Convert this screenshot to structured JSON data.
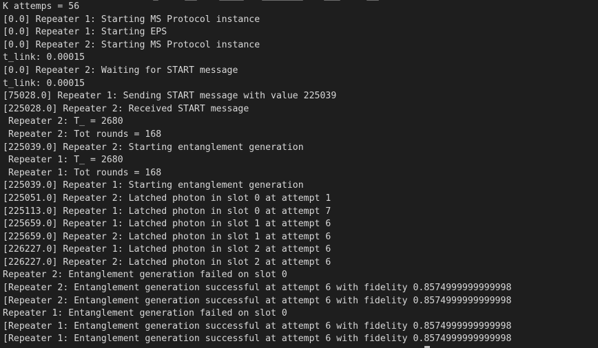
{
  "terminal": {
    "lines": [
      "K attemps = 56",
      "[0.0] Repeater 1: Starting MS Protocol instance",
      "[0.0] Repeater 1: Starting EPS",
      "[0.0] Repeater 2: Starting MS Protocol instance",
      "t_link: 0.00015",
      "[0.0] Repeater 2: Waiting for START message",
      "t_link: 0.00015",
      "[75028.0] Repeater 1: Sending START message with value 225039",
      "[225028.0] Repeater 2: Received START message",
      " Repeater 2: T_ = 2680",
      " Repeater 2: Tot rounds = 168",
      "[225039.0] Repeater 2: Starting entanglement generation",
      " Repeater 1: T_ = 2680",
      " Repeater 1: Tot rounds = 168",
      "[225039.0] Repeater 1: Starting entanglement generation",
      "[225051.0] Repeater 2: Latched photon in slot 0 at attempt 1",
      "[225113.0] Repeater 1: Latched photon in slot 0 at attempt 7",
      "[225659.0] Repeater 1: Latched photon in slot 1 at attempt 6",
      "[225659.0] Repeater 2: Latched photon in slot 1 at attempt 6",
      "[226227.0] Repeater 1: Latched photon in slot 2 at attempt 6",
      "[226227.0] Repeater 2: Latched photon in slot 2 at attempt 6",
      "Repeater 2: Entanglement generation failed on slot 0",
      "[Repeater 2: Entanglement generation successful at attempt 6 with fidelity 0.8574999999999998",
      "[Repeater 2: Entanglement generation successful at attempt 6 with fidelity 0.8574999999999998",
      "Repeater 1: Entanglement generation failed on slot 0",
      "[Repeater 1: Entanglement generation successful at attempt 6 with fidelity 0.8574999999999998",
      "[Repeater 1: Entanglement generation successful at attempt 6 with fidelity 0.8574999999999998"
    ]
  },
  "colors": {
    "background": "#1e1e1e",
    "text": "#d8d8d8"
  }
}
